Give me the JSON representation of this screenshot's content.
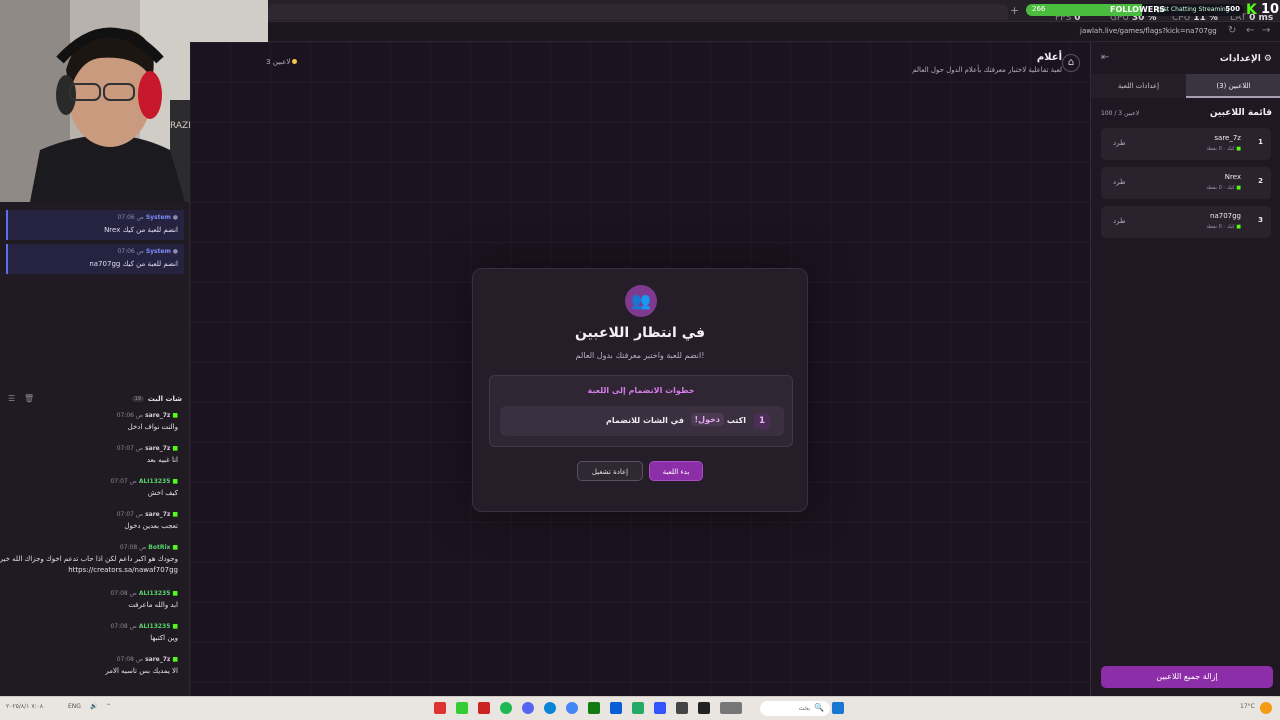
{
  "browser": {
    "url": "jawlah.live/games/flags?kick=na707gg",
    "perf": {
      "fps_label": "FPS",
      "fps": "0",
      "gpu_label": "GPU",
      "gpu": "30 %",
      "cpu_label": "CPU",
      "cpu": "11 %",
      "lat_label": "LAT",
      "lat": "0 ms"
    }
  },
  "overlay": {
    "followers_count": "266",
    "followers_label": "FOLLOWERS",
    "followers_sub": "Just Chatting Streaming",
    "followers_goal": "500",
    "followers_progress": 0.53,
    "stat": "10",
    "accent": "#4bbd3e"
  },
  "system_messages": [
    {
      "name": "System",
      "time": "07:06 ص",
      "text": "Nrex انضم للعبة من كيك"
    },
    {
      "name": "System",
      "time": "07:06 ص",
      "text": "na707gg انضم للعبة من كيك"
    }
  ],
  "chat": {
    "title": "شات البث",
    "count": "19",
    "messages": [
      {
        "name": "sare_7z",
        "time": "07:06 ص",
        "text": "والنت نواف ادخل",
        "green": false
      },
      {
        "name": "sare_7z",
        "time": "07:07 ص",
        "text": "انا غبيه بعد",
        "green": false
      },
      {
        "name": "ALI13235",
        "time": "07:07 ص",
        "text": "كيف اخش",
        "green": true
      },
      {
        "name": "sare_7z",
        "time": "07:07 ص",
        "text": "تعجب بعدين دخول",
        "green": false
      },
      {
        "name": "BotRix",
        "time": "07:08 ص",
        "text": "وجودك هو اكبر داعم لكن اذا حاب تدعم اخوك وجزاك الله خير",
        "text2": "https://creators.sa/nawaf707gg",
        "green": true
      },
      {
        "name": "ALI13235",
        "time": "07:08 ص",
        "text": "ابد والله ماعرفت",
        "green": true
      },
      {
        "name": "ALI13235",
        "time": "07:08 ص",
        "text": "وين اكتبها",
        "green": true
      },
      {
        "name": "sare_7z",
        "time": "07:08 ص",
        "text": "الا يمديك بس تاسيه الامر",
        "green": false
      }
    ]
  },
  "game": {
    "badge": "3 لاعبين",
    "title": "أعلام",
    "subtitle": "لعبة تفاعلية لاختبار معرفتك بأعلام الدول حول العالم",
    "modal": {
      "title": "في انتظار اللاعبين",
      "subtitle": "انضم للعبة واختبر معرفتك بدول العالم!",
      "steps_title": "خطوات الانضمام إلى اللعبة",
      "step_num": "1",
      "step_word1": "اكتب",
      "step_keyword": "!دخول",
      "step_word2": "في الشات للانضمام",
      "start_button": "بدء اللعبة",
      "reset_button": "إعادة تشغيل"
    }
  },
  "settings": {
    "title": "الإعدادات",
    "tabs": [
      "إعدادات اللعبة",
      "اللاعبين (3)"
    ],
    "list_title": "قائمة اللاعبين",
    "list_count": "100 / 3 لاعبين",
    "players": [
      {
        "index": "1",
        "name": "sare_7z",
        "meta": "كيك · 0 نقطة",
        "kick": "طرد"
      },
      {
        "index": "2",
        "name": "Nrex",
        "meta": "كيك · 0 نقطة",
        "kick": "طرد"
      },
      {
        "index": "3",
        "name": "na707gg",
        "meta": "كيك · 0 نقطة",
        "kick": "طرد"
      }
    ],
    "remove_all": "إزالة جميع اللاعبين"
  },
  "taskbar": {
    "time": "٧:٠٨",
    "date": "٢٠٢٥/٨/١",
    "lang": "ENG",
    "search": "بحث",
    "weather": "17°C"
  }
}
